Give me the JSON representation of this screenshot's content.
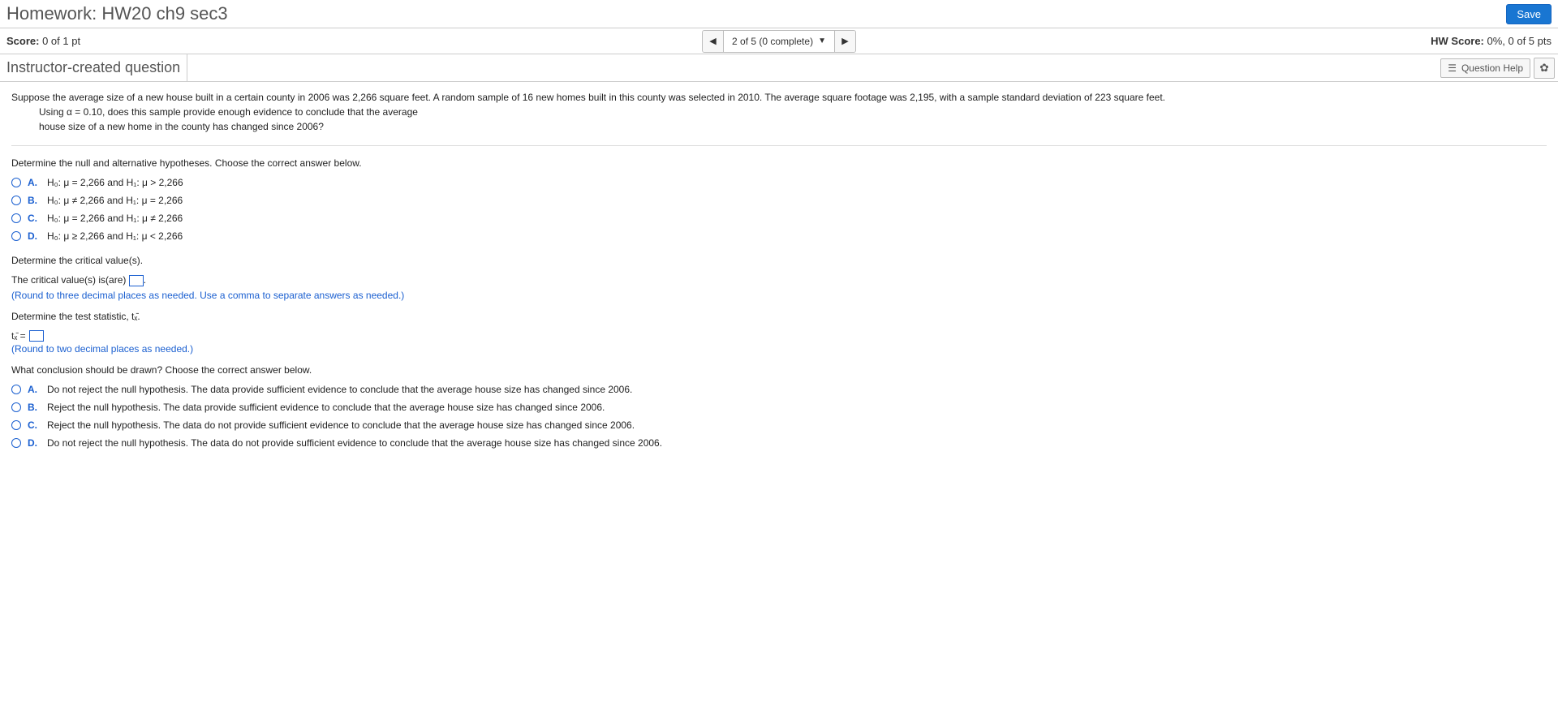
{
  "header": {
    "title": "Homework: HW20 ch9 sec3",
    "save_label": "Save"
  },
  "scorebar": {
    "score_label": "Score:",
    "score_value": " 0 of 1 pt",
    "nav_text": "2 of 5 (0 complete)",
    "hw_score_label": "HW Score:",
    "hw_score_value": " 0%, 0 of 5 pts"
  },
  "subheader": {
    "left": "Instructor-created question",
    "help_label": "Question Help"
  },
  "stem": {
    "line1": "Suppose the average size of a new house built in a certain county in 2006 was 2,266 square feet. A random sample of 16 new homes built in this county was selected in 2010. The average square footage was 2,195, with a sample standard deviation of 223 square feet.",
    "line2": "Using α = 0.10, does this sample provide enough evidence to conclude that the average",
    "line3": "house size of a new home in the county has changed since 2006?"
  },
  "part1": {
    "prompt": "Determine the null and alternative hypotheses. Choose the correct answer below.",
    "options": {
      "a": "H₀: μ = 2,266 and H₁: μ > 2,266",
      "b": "H₀: μ ≠ 2,266 and H₁: μ = 2,266",
      "c": "H₀: μ = 2,266 and H₁: μ ≠ 2,266",
      "d": "H₀: μ ≥ 2,266 and H₁: μ < 2,266"
    }
  },
  "part2": {
    "prompt": "Determine the critical value(s).",
    "line_pre": "The critical value(s) is(are) ",
    "line_post": ".",
    "hint": "(Round to three decimal places as needed. Use a comma to separate answers as needed.)"
  },
  "part3": {
    "prompt": "Determine the test statistic, tₓ̄.",
    "eq_lhs": "tₓ̄ = ",
    "hint": "(Round to two decimal places as needed.)"
  },
  "part4": {
    "prompt": "What conclusion should be drawn? Choose the correct answer below.",
    "options": {
      "a": "Do not reject the null hypothesis. The data provide sufficient evidence to conclude that the average house size has changed since 2006.",
      "b": "Reject the null hypothesis. The data provide sufficient evidence to conclude that the average house size has changed since 2006.",
      "c": "Reject the null hypothesis. The data do not provide sufficient evidence to conclude that the average house size has changed since 2006.",
      "d": "Do not reject the null hypothesis. The data do not provide sufficient evidence to conclude that the average house size has changed since 2006."
    }
  },
  "letters": {
    "a": "A.",
    "b": "B.",
    "c": "C.",
    "d": "D."
  }
}
